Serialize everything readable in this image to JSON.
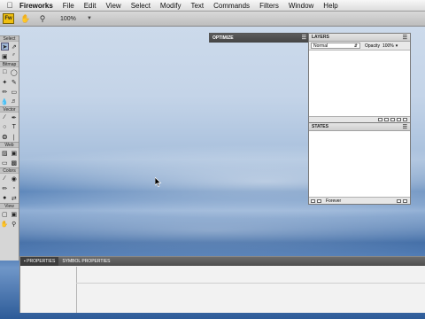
{
  "menubar": {
    "apple_icon": "apple-icon",
    "app_name": "Fireworks",
    "items": [
      "File",
      "Edit",
      "View",
      "Select",
      "Modify",
      "Text",
      "Commands",
      "Filters",
      "Window",
      "Help"
    ]
  },
  "toolbar": {
    "logo": "Fw",
    "zoom": "100%"
  },
  "tools": {
    "sections": [
      "Select",
      "Bitmap",
      "Vector",
      "Web",
      "Colors",
      "View"
    ]
  },
  "optimize": {
    "title": "OPTIMIZE"
  },
  "layers": {
    "title": "LAYERS",
    "blend_mode": "Normal",
    "opacity_label": "Opacity",
    "opacity_value": "100%"
  },
  "states": {
    "title": "STATES",
    "loop": "Forever"
  },
  "properties": {
    "tabs": [
      "PROPERTIES",
      "SYMBOL PROPERTIES"
    ]
  },
  "colors": {
    "wallpaper_accent": "#3d6ea8",
    "panel_header": "#4f4f4f",
    "fw_logo": "#f0c010"
  }
}
